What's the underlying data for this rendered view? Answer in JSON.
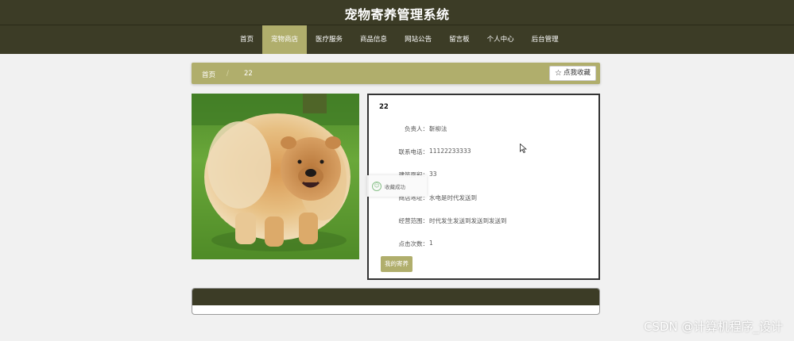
{
  "site": {
    "title": "宠物寄养管理系统"
  },
  "nav": {
    "items": [
      {
        "label": "首页"
      },
      {
        "label": "宠物商店"
      },
      {
        "label": "医疗服务"
      },
      {
        "label": "商品信息"
      },
      {
        "label": "网站公告"
      },
      {
        "label": "留言板"
      },
      {
        "label": "个人中心"
      },
      {
        "label": "后台管理"
      }
    ],
    "active_label": "宠物商店"
  },
  "breadcrumb": {
    "home": "首页",
    "separator": "/",
    "current": "22"
  },
  "favorite_button": {
    "label": "点我收藏",
    "icon": "star-icon"
  },
  "detail": {
    "name": "22",
    "fields": [
      {
        "label": "负责人：",
        "value": "靳柳法"
      },
      {
        "label": "联系电话：",
        "value": "11122233333"
      },
      {
        "label": "建筑面积：",
        "value": "33"
      },
      {
        "label": "商店地址：",
        "value": "水电是时代发送到"
      },
      {
        "label": "经营范围：",
        "value": "时代发生发送到发送到发送到"
      },
      {
        "label": "点击次数：",
        "value": "1"
      }
    ],
    "book_button": "我的寄养"
  },
  "toast": {
    "text": "收藏成功",
    "icon": "smile-icon"
  },
  "watermark": "CSDN @计算机程序_设计",
  "colors": {
    "header_bg": "#3c3c26",
    "accent": "#b0ae6c",
    "page_bg": "#f1f1f1"
  }
}
